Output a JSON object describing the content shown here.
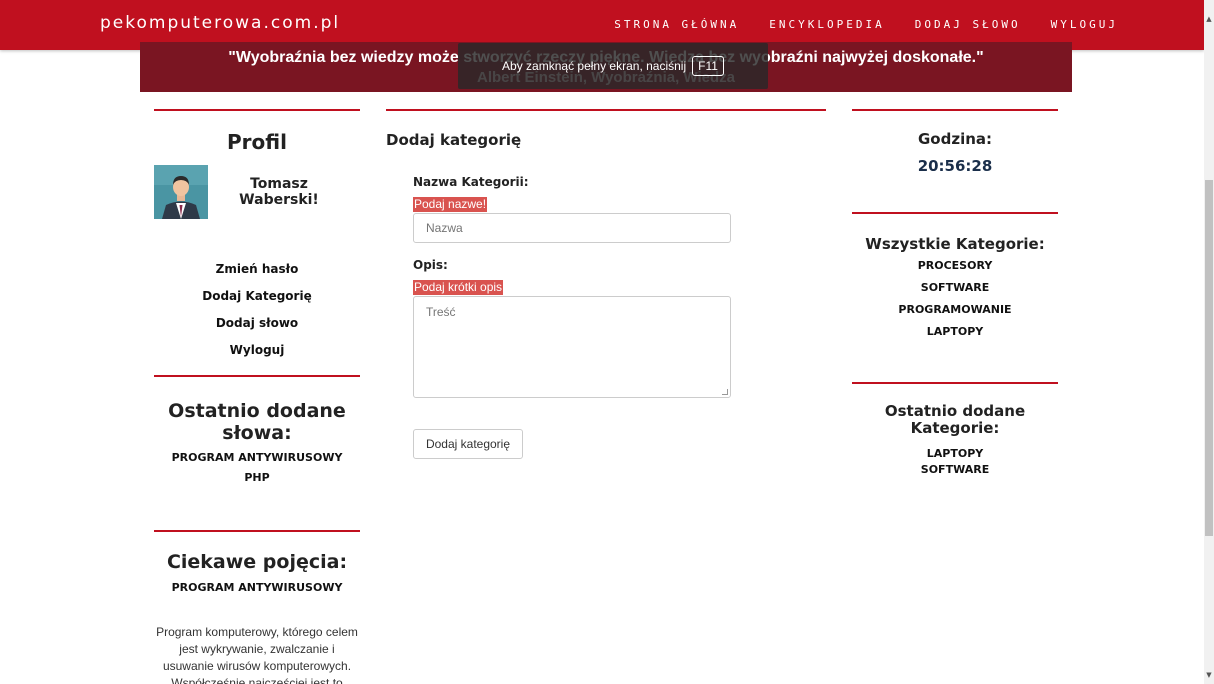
{
  "navbar": {
    "brand": "pekomputerowa.com.pl",
    "links": [
      "STRONA GŁÓWNA",
      "ENCYKLOPEDIA",
      "DODAJ SŁOWO",
      "WYLOGUJ"
    ]
  },
  "quote": {
    "text": "\"Wyobraźnia bez wiedzy może stworzyć rzeczy piękne. Wiedza bez wyobraźni najwyżej doskonałe.\"",
    "author": "Albert Einstein, Wyobraźnia, Wiedza"
  },
  "fullscreen_hint": {
    "text": "Aby zamknąć pełny ekran, naciśnij",
    "key": "F11"
  },
  "profile": {
    "heading": "Profil",
    "user_name": "Tomasz Waberski!",
    "links": [
      "Zmień hasło",
      "Dodaj Kategorię",
      "Dodaj słowo",
      "Wyloguj"
    ]
  },
  "recent_words": {
    "heading": "Ostatnio dodane słowa:",
    "items": [
      "PROGRAM ANTYWIRUSOWY",
      "PHP"
    ]
  },
  "interesting": {
    "heading": "Ciekawe pojęcia:",
    "term": "PROGRAM ANTYWIRUSOWY",
    "description": "Program komputerowy, którego celem jest wykrywanie, zwalczanie i usuwanie wirusów komputerowych. Współcześnie najczęściej jest to"
  },
  "form": {
    "title": "Dodaj kategorię",
    "name_label": "Nazwa Kategorii:",
    "name_error": "Podaj nazwe!",
    "name_placeholder": "Nazwa",
    "desc_label": "Opis:",
    "desc_error": "Podaj krótki opis",
    "desc_placeholder": "Treść",
    "submit_label": "Dodaj kategorię"
  },
  "clock": {
    "heading": "Godzina:",
    "time": "20:56:28"
  },
  "all_categories": {
    "heading": "Wszystkie Kategorie:",
    "items": [
      "PROCESORY",
      "SOFTWARE",
      "PROGRAMOWANIE",
      "LAPTOPY"
    ]
  },
  "recent_categories": {
    "heading": "Ostatnio dodane Kategorie:",
    "items": [
      "LAPTOPY",
      "SOFTWARE"
    ]
  },
  "colors": {
    "navbar": "#c0101f",
    "quote_bar": "#7a1522",
    "error_badge": "#d9534f",
    "clock_text": "#1a2e4a"
  }
}
